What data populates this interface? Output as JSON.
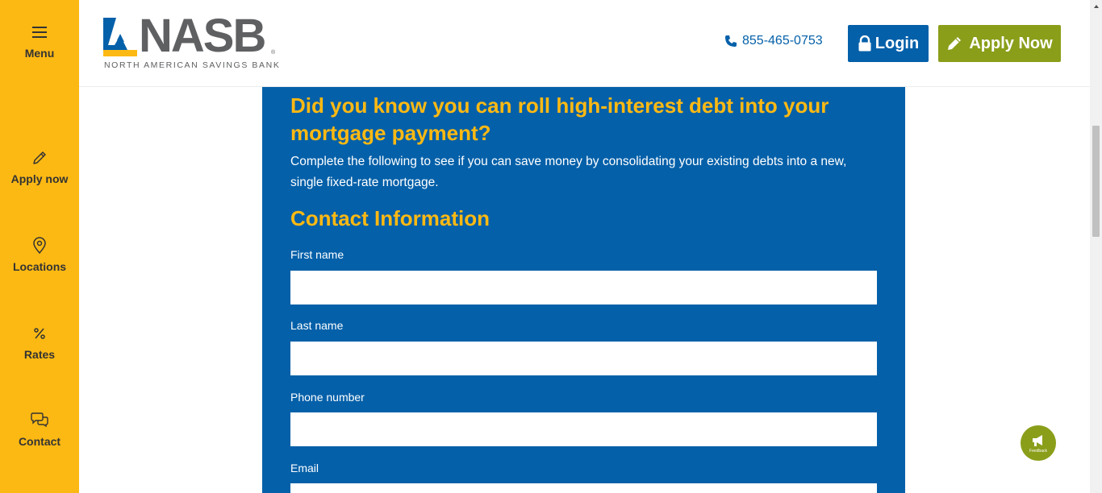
{
  "sidebar": {
    "items": [
      {
        "label": "Menu",
        "icon": "hamburger-icon"
      },
      {
        "label": "Apply now",
        "icon": "pencil-icon"
      },
      {
        "label": "Locations",
        "icon": "map-pin-icon"
      },
      {
        "label": "Rates",
        "icon": "percent-icon"
      },
      {
        "label": "Contact",
        "icon": "chat-bubbles-icon"
      }
    ],
    "background": "#FDB913"
  },
  "header": {
    "logo_text": "NASB",
    "logo_tagline": "NORTH AMERICAN SAVINGS BANK",
    "phone": "855-465-0753",
    "login_label": "Login",
    "apply_label": "Apply Now"
  },
  "form": {
    "headline": "Did you know you can roll high-interest debt into your mortgage payment?",
    "intro": "Complete the following to see if you can save money by consolidating your existing debts into a new, single fixed-rate mortgage.",
    "section_title": "Contact Information",
    "fields": [
      {
        "label": "First name",
        "value": ""
      },
      {
        "label": "Last name",
        "value": ""
      },
      {
        "label": "Phone number",
        "value": ""
      },
      {
        "label": "Email",
        "value": ""
      }
    ]
  },
  "feedback": {
    "label": "Feedback",
    "icon": "megaphone-icon"
  },
  "colors": {
    "brand_blue": "#0460A9",
    "brand_yellow": "#FDB913",
    "apply_green": "#8B9E1A",
    "logo_gray": "#5f6062"
  }
}
